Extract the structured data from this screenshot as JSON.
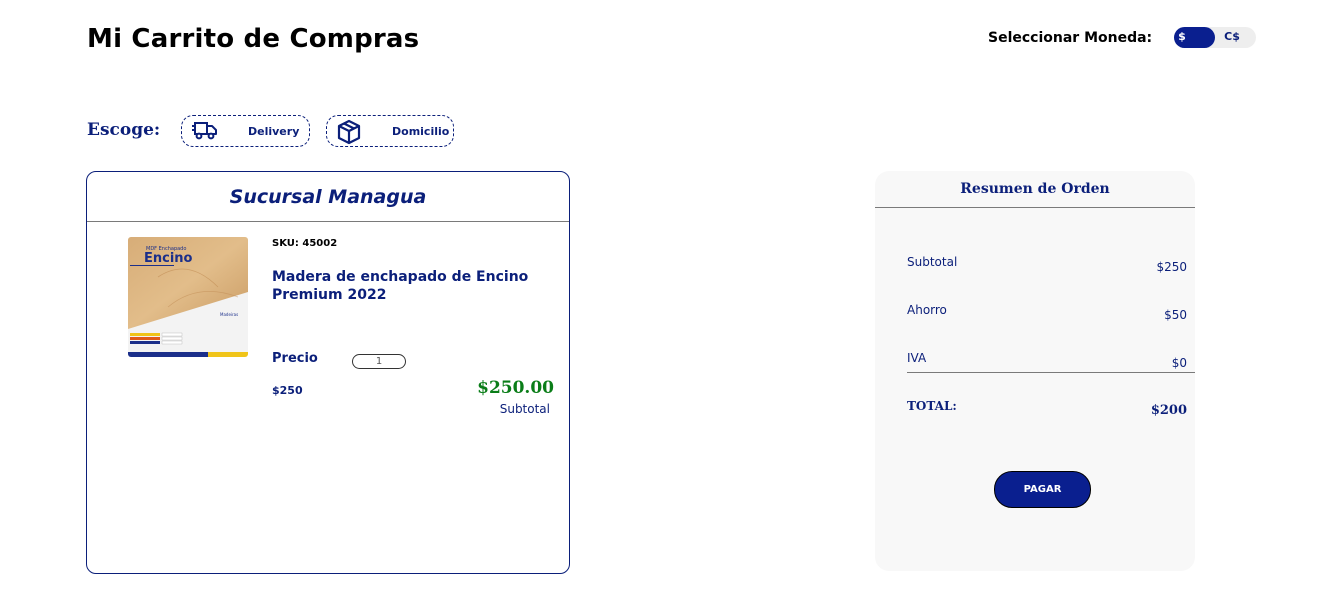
{
  "header": {
    "title": "Mi Carrito de Compras",
    "currency_label": "Seleccionar Moneda:",
    "currency_options": [
      "$",
      "C$"
    ],
    "currency_selected": "$"
  },
  "shipping": {
    "label": "Escoge:",
    "options": [
      {
        "label": "Delivery",
        "icon": "truck-icon"
      },
      {
        "label": "Domicilio",
        "icon": "box-icon"
      }
    ]
  },
  "cart": {
    "branch": "Sucursal Managua",
    "items": [
      {
        "image_text": {
          "brand_small": "MDF Enchapado",
          "brand": "Encino",
          "variant": "Madeiras"
        },
        "sku": "SKU: 45002",
        "name": "Madera de enchapado de Encino Premium 2022",
        "price_label": "Precio",
        "quantity": "1",
        "unit_price": "$250",
        "line_total": "$250.00",
        "line_total_label": "Subtotal"
      }
    ]
  },
  "summary": {
    "title": "Resumen de Orden",
    "rows": [
      {
        "label": "Subtotal",
        "value": "$250"
      },
      {
        "label": "Ahorro",
        "value": "$50"
      },
      {
        "label": "IVA",
        "value": "$0"
      }
    ],
    "total_label": "TOTAL:",
    "total_value": "$200",
    "pay_button": "PAGAR"
  },
  "colors": {
    "brand_blue": "#0a1f8f",
    "text_blue": "#0b1f7a",
    "price_green": "#0a7d18",
    "panel_bg": "#f8f8f8"
  }
}
